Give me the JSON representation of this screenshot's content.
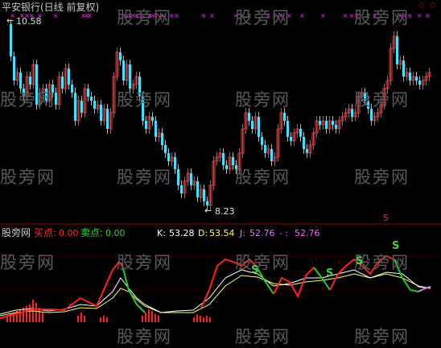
{
  "header": {
    "title": "平安银行(日线 前复权)",
    "title_color": "#c8c8c8",
    "corner_markers": [
      "◇",
      "◇"
    ],
    "corner_marker_color": "#c00000"
  },
  "main_panel": {
    "high_label": "10.58",
    "low_label": "8.23",
    "sell_marker": "S"
  },
  "indicator_panel": {
    "name": "股旁网",
    "buy": {
      "label": "买点:",
      "value": "0.00",
      "color": "#ff3030"
    },
    "sell": {
      "label": "卖点:",
      "value": "0.00",
      "color": "#40d040"
    },
    "k": {
      "label": "K:",
      "value": "53.28",
      "color": "#ffffff"
    },
    "d": {
      "label": "D:",
      "value": "53.54",
      "color": "#ffff60"
    },
    "j": {
      "label": "J:",
      "value": "52.76",
      "color": "#d080ff"
    },
    "extra": {
      "label": "- :",
      "value": "52.76",
      "color": "#ff60ff"
    },
    "s_markers": [
      "S",
      "S",
      "S",
      "S"
    ]
  },
  "watermark": "股旁网",
  "colors": {
    "up": "#ff3030",
    "down": "#40e0ff",
    "k": "#ffffff",
    "d": "#ffff60",
    "j_up": "#ff2020",
    "j_down": "#20d020",
    "grid": "#8b0000"
  }
}
